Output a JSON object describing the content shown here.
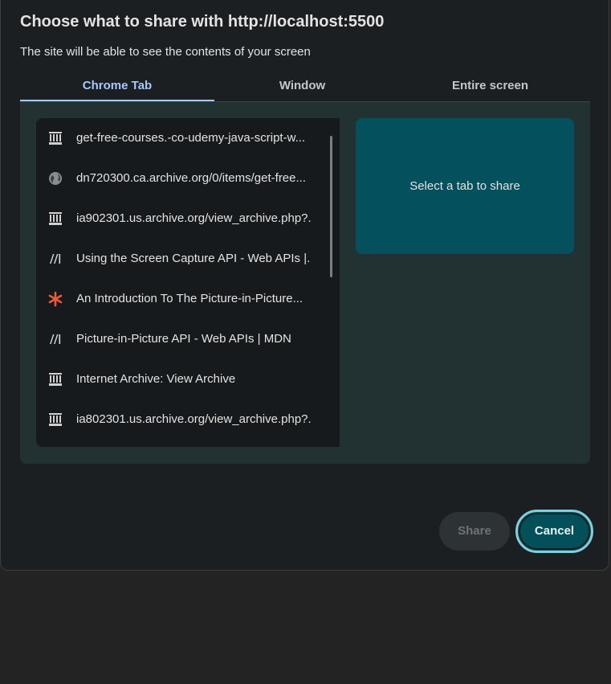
{
  "dialog": {
    "title": "Choose what to share with http://localhost:5500",
    "subtitle": "The site will be able to see the contents of your screen"
  },
  "tabs": [
    {
      "label": "Chrome Tab",
      "selected": true
    },
    {
      "label": "Window",
      "selected": false
    },
    {
      "label": "Entire screen",
      "selected": false
    }
  ],
  "tab_list": {
    "items": [
      {
        "label": "get-free-courses.-co-udemy-java-script-w...",
        "icon": "archive-building-icon"
      },
      {
        "label": "dn720300.ca.archive.org/0/items/get-free...",
        "icon": "globe-icon"
      },
      {
        "label": "ia902301.us.archive.org/view_archive.php?...",
        "icon": "archive-building-icon"
      },
      {
        "label": "Using the Screen Capture API - Web APIs |...",
        "icon": "mdn-icon"
      },
      {
        "label": "An Introduction To The Picture-in-Picture...",
        "icon": "smashing-asterisk-icon"
      },
      {
        "label": "Picture-in-Picture API - Web APIs | MDN",
        "icon": "mdn-icon"
      },
      {
        "label": "Internet Archive: View Archive",
        "icon": "archive-building-icon"
      },
      {
        "label": "ia802301.us.archive.org/view_archive.php?...",
        "icon": "archive-building-icon"
      }
    ]
  },
  "preview": {
    "text": "Select a tab to share"
  },
  "buttons": {
    "share_label": "Share",
    "cancel_label": "Cancel"
  },
  "colors": {
    "accent": "#a8c7fa",
    "preview_bg": "#04505c",
    "cancel_bg": "#03505b",
    "cancel_ring": "#7fd0dc",
    "asterisk": "#e85b3c"
  }
}
